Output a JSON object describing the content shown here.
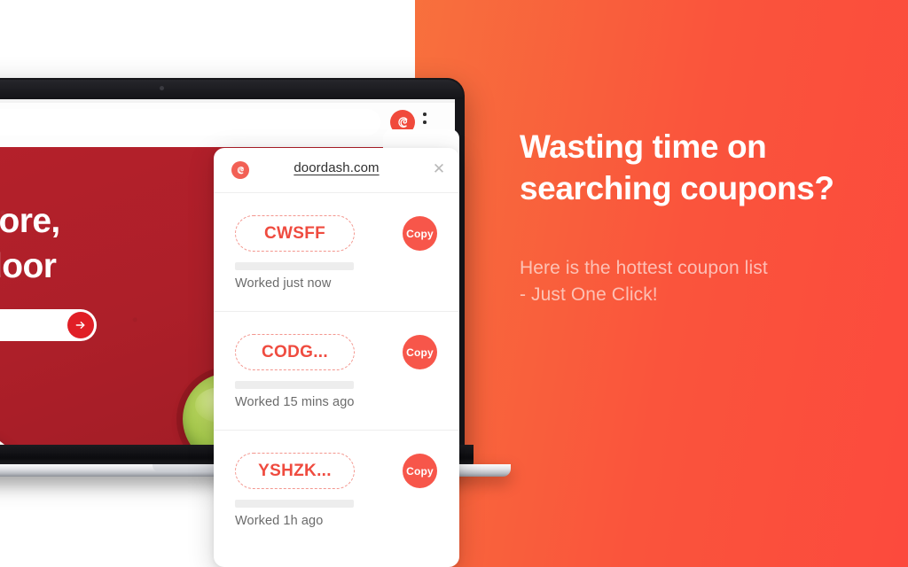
{
  "theme": {
    "gradient_start": "#F5823F",
    "gradient_end": "#FC4A3D",
    "brand_red": "#F7564A",
    "code_red": "#EF4B3F",
    "panel_white": "#FFFFFF",
    "doordash_red": "#B5202B"
  },
  "browser": {
    "extension_icon": "extension-logo-icon",
    "menu_icon": "kebab-menu-icon",
    "address_value": "",
    "address_placeholder": ""
  },
  "webpage": {
    "hero_heading": "d more,\nur door",
    "search_value": "",
    "search_placeholder": "",
    "submit_icon": "arrow-right-icon",
    "food_items": [
      "guacamole-bowl",
      "plate-of-food"
    ]
  },
  "popup": {
    "logo_icon": "extension-logo-icon",
    "domain": "doordash.com",
    "close_icon": "close-icon",
    "copy_label": "Copy",
    "coupons": [
      {
        "code": "CWSFF",
        "status": "Worked just now"
      },
      {
        "code": "CODG...",
        "status": "Worked 15 mins ago"
      },
      {
        "code": "YSHZK...",
        "status": "Worked 1h ago"
      }
    ]
  },
  "marketing": {
    "headline": "Wasting time on\nsearching coupons?",
    "subhead": "Here is the hottest coupon list\n- Just One Click!"
  }
}
